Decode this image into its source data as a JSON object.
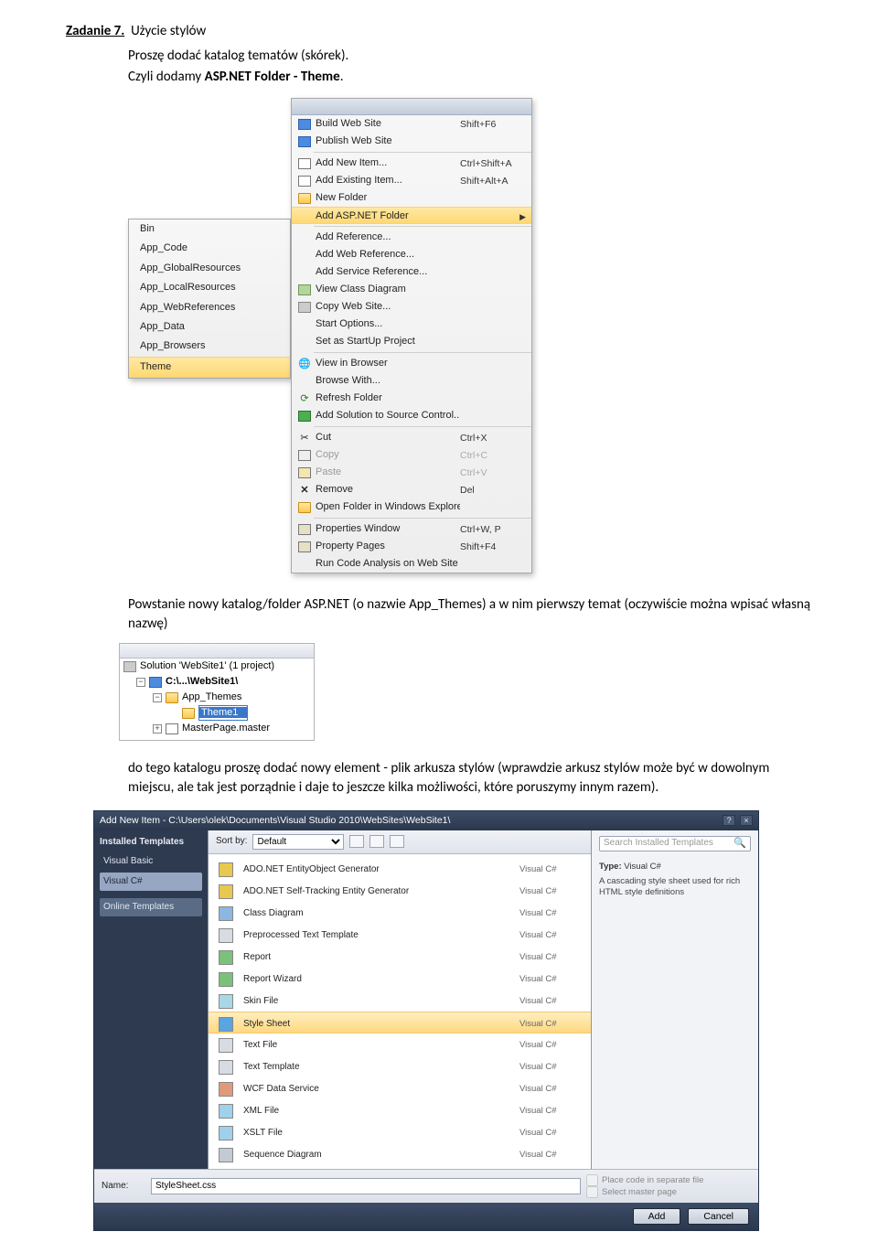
{
  "heading": {
    "task": "Zadanie 7.",
    "title": "Użycie stylów",
    "line1": "Proszę dodać katalog tematów (skórek).",
    "line2a": "Czyli dodamy ",
    "line2b_bold": "ASP.NET Folder - Theme",
    "line2c": "."
  },
  "submenu": {
    "items": [
      {
        "label": "Bin",
        "hl": false
      },
      {
        "label": "App_Code",
        "hl": false
      },
      {
        "label": "App_GlobalResources",
        "hl": false
      },
      {
        "label": "App_LocalResources",
        "hl": false
      },
      {
        "label": "App_WebReferences",
        "hl": false
      },
      {
        "label": "App_Data",
        "hl": false
      },
      {
        "label": "App_Browsers",
        "hl": false
      },
      {
        "label": "Theme",
        "hl": true
      }
    ]
  },
  "mainmenu": {
    "topstrip": "",
    "groups": [
      [
        {
          "icon": "blue",
          "label": "Build Web Site",
          "shortcut": "Shift+F6"
        },
        {
          "icon": "blue",
          "label": "Publish Web Site",
          "shortcut": ""
        }
      ],
      [
        {
          "icon": "box",
          "label": "Add New Item...",
          "shortcut": "Ctrl+Shift+A"
        },
        {
          "icon": "box",
          "label": "Add Existing Item...",
          "shortcut": "Shift+Alt+A"
        },
        {
          "icon": "folder",
          "label": "New Folder",
          "shortcut": ""
        },
        {
          "icon": "",
          "label": "Add ASP.NET Folder",
          "shortcut": "",
          "hl": true,
          "arrow": true
        }
      ],
      [
        {
          "icon": "",
          "label": "Add Reference...",
          "shortcut": ""
        },
        {
          "icon": "",
          "label": "Add Web Reference...",
          "shortcut": ""
        },
        {
          "icon": "",
          "label": "Add Service Reference...",
          "shortcut": ""
        },
        {
          "icon": "graygreen",
          "label": "View Class Diagram",
          "shortcut": ""
        },
        {
          "icon": "gray",
          "label": "Copy Web Site...",
          "shortcut": ""
        },
        {
          "icon": "",
          "label": "Start Options...",
          "shortcut": ""
        },
        {
          "icon": "",
          "label": "Set as StartUp Project",
          "shortcut": ""
        }
      ],
      [
        {
          "icon": "globe",
          "label": "View in Browser",
          "shortcut": ""
        },
        {
          "icon": "",
          "label": "Browse With...",
          "shortcut": ""
        },
        {
          "icon": "refresh",
          "label": "Refresh Folder",
          "shortcut": ""
        },
        {
          "icon": "green",
          "label": "Add Solution to Source Control...",
          "shortcut": ""
        }
      ],
      [
        {
          "icon": "cut",
          "label": "Cut",
          "shortcut": "Ctrl+X"
        },
        {
          "icon": "copy",
          "label": "Copy",
          "shortcut": "Ctrl+C",
          "dis": true
        },
        {
          "icon": "paste",
          "label": "Paste",
          "shortcut": "Ctrl+V",
          "dis": true
        },
        {
          "icon": "x",
          "label": "Remove",
          "shortcut": "Del"
        },
        {
          "icon": "folder",
          "label": "Open Folder in Windows Explorer",
          "shortcut": ""
        }
      ],
      [
        {
          "icon": "prop",
          "label": "Properties Window",
          "shortcut": "Ctrl+W, P"
        },
        {
          "icon": "prop",
          "label": "Property Pages",
          "shortcut": "Shift+F4"
        },
        {
          "icon": "",
          "label": "Run Code Analysis on Web Site",
          "shortcut": ""
        }
      ]
    ]
  },
  "para2a": "Powstanie nowy katalog/folder ASP.NET (o nazwie App_Themes) a w nim pierwszy temat (oczywiście można wpisać własną nazwę)",
  "solution": {
    "sol_label": "Solution 'WebSite1' (1 project)",
    "proj_label": "C:\\...\\WebSite1\\",
    "folder_label": "App_Themes",
    "editing_value": "Theme1",
    "master_label": "MasterPage.master"
  },
  "para3": "do tego katalogu proszę dodać nowy element - plik arkusza stylów (wprawdzie arkusz stylów może być w dowolnym miejscu, ale tak jest porządnie i daje to jeszcze kilka możliwości, które poruszymy innym razem).",
  "dialog": {
    "title": "Add New Item - C:\\Users\\olek\\Documents\\Visual Studio 2010\\WebSites\\WebSite1\\",
    "left_header": "Installed Templates",
    "left_items": [
      {
        "label": "Visual Basic",
        "sel": false
      },
      {
        "label": "Visual C#",
        "sel": true
      }
    ],
    "left_bar": "Online Templates",
    "sortby_label": "Sort by:",
    "sortby_value": "Default",
    "search_placeholder": "Search Installed Templates",
    "right_type_label": "Type:",
    "right_type_value": "Visual C#",
    "right_desc": "A cascading style sheet used for rich HTML style definitions",
    "lang": "Visual C#",
    "items": [
      {
        "label": "ADO.NET EntityObject Generator",
        "hl": false,
        "color": "#e8c84e"
      },
      {
        "label": "ADO.NET Self-Tracking Entity Generator",
        "hl": false,
        "color": "#e8c84e"
      },
      {
        "label": "Class Diagram",
        "hl": false,
        "color": "#8bb7e0"
      },
      {
        "label": "Preprocessed Text Template",
        "hl": false,
        "color": "#d7dbe2"
      },
      {
        "label": "Report",
        "hl": false,
        "color": "#7ac27a"
      },
      {
        "label": "Report Wizard",
        "hl": false,
        "color": "#7ac27a"
      },
      {
        "label": "Skin File",
        "hl": false,
        "color": "#a8d8e8"
      },
      {
        "label": "Style Sheet",
        "hl": true,
        "color": "#5aa4e0"
      },
      {
        "label": "Text File",
        "hl": false,
        "color": "#d7dbe2"
      },
      {
        "label": "Text Template",
        "hl": false,
        "color": "#d7dbe2"
      },
      {
        "label": "WCF Data Service",
        "hl": false,
        "color": "#e09a7a"
      },
      {
        "label": "XML File",
        "hl": false,
        "color": "#9fd0ec"
      },
      {
        "label": "XSLT File",
        "hl": false,
        "color": "#9fd0ec"
      },
      {
        "label": "Sequence Diagram",
        "hl": false,
        "color": "#c4cad4"
      }
    ],
    "name_label": "Name:",
    "name_value": "StyleSheet.css",
    "chk1": "Place code in separate file",
    "chk2": "Select master page",
    "btn_add": "Add",
    "btn_cancel": "Cancel"
  }
}
